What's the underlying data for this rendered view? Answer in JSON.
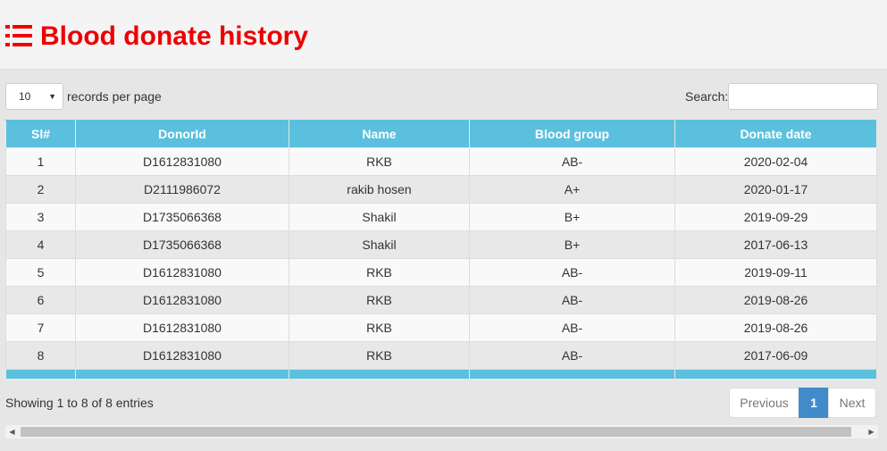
{
  "header": {
    "title": "Blood donate history",
    "icon": "list-icon",
    "title_color": "#ee0000"
  },
  "controls": {
    "length_value": "10",
    "length_label": "records per page",
    "search_label": "Search:",
    "search_value": "",
    "search_placeholder": ""
  },
  "table": {
    "header_color": "#5bc0de",
    "columns": [
      "Sl#",
      "DonorId",
      "Name",
      "Blood group",
      "Donate date"
    ],
    "rows": [
      [
        "1",
        "D1612831080",
        "RKB",
        "AB-",
        "2020-02-04"
      ],
      [
        "2",
        "D2111986072",
        "rakib hosen",
        "A+",
        "2020-01-17"
      ],
      [
        "3",
        "D1735066368",
        "Shakil",
        "B+",
        "2019-09-29"
      ],
      [
        "4",
        "D1735066368",
        "Shakil",
        "B+",
        "2017-06-13"
      ],
      [
        "5",
        "D1612831080",
        "RKB",
        "AB-",
        "2019-09-11"
      ],
      [
        "6",
        "D1612831080",
        "RKB",
        "AB-",
        "2019-08-26"
      ],
      [
        "7",
        "D1612831080",
        "RKB",
        "AB-",
        "2019-08-26"
      ],
      [
        "8",
        "D1612831080",
        "RKB",
        "AB-",
        "2017-06-09"
      ]
    ]
  },
  "footer": {
    "info": "Showing 1 to 8 of 8 entries",
    "prev_label": "Previous",
    "current_page": "1",
    "next_label": "Next",
    "pager_active_color": "#428bca"
  }
}
